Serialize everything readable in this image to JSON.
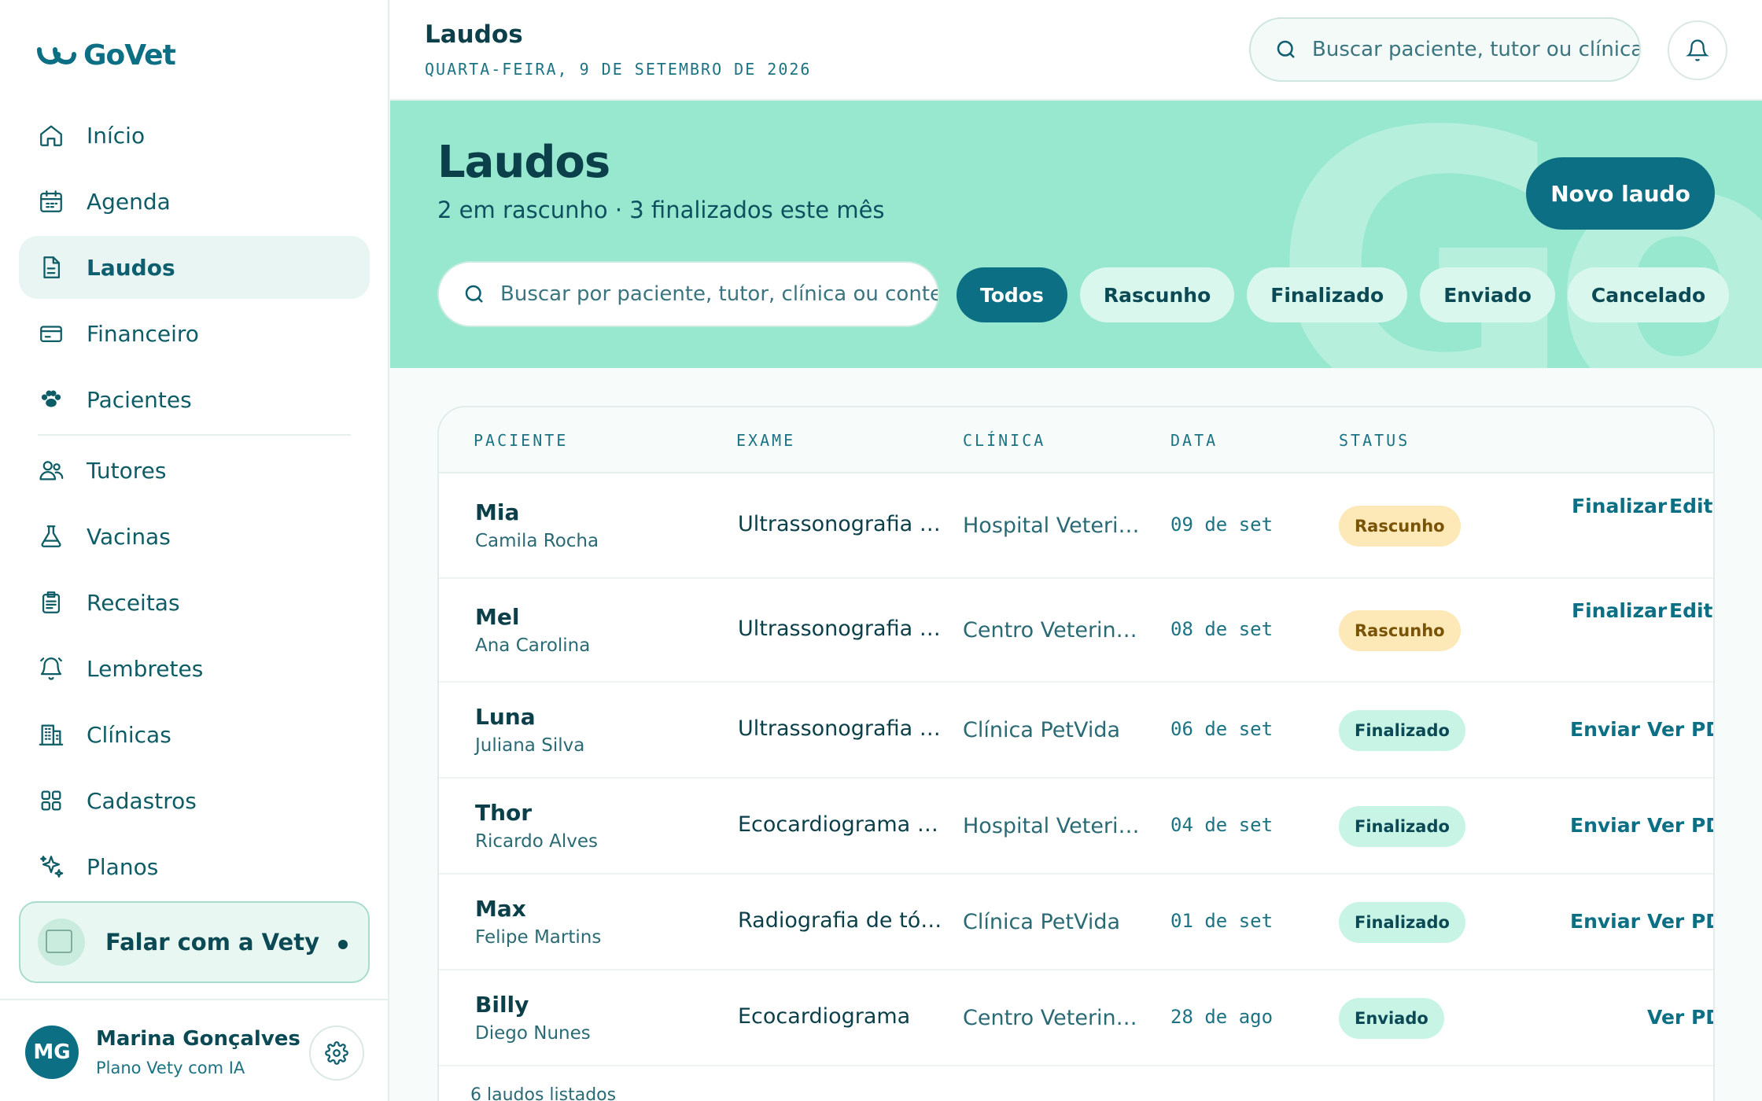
{
  "brand": {
    "name": "GoVet"
  },
  "nav": {
    "items": [
      {
        "label": "Início",
        "icon": "home-icon"
      },
      {
        "label": "Agenda",
        "icon": "calendar-icon"
      },
      {
        "label": "Laudos",
        "icon": "document-icon"
      },
      {
        "label": "Financeiro",
        "icon": "credit-card-icon"
      },
      {
        "label": "Pacientes",
        "icon": "paw-icon"
      },
      {
        "label": "Tutores",
        "icon": "users-icon"
      },
      {
        "label": "Vacinas",
        "icon": "flask-icon"
      },
      {
        "label": "Receitas",
        "icon": "clipboard-icon"
      },
      {
        "label": "Lembretes",
        "icon": "bell-ring-icon"
      },
      {
        "label": "Clínicas",
        "icon": "building-icon"
      },
      {
        "label": "Cadastros",
        "icon": "grid-icon"
      },
      {
        "label": "Planos",
        "icon": "sparkles-icon"
      }
    ],
    "active": "Laudos"
  },
  "assistant": {
    "label": "Falar com a Vety"
  },
  "user": {
    "initials": "MG",
    "name": "Marina Gonçalves",
    "plan": "Plano Vety com IA"
  },
  "topbar": {
    "title": "Laudos",
    "date": "QUARTA-FEIRA, 9 DE SETEMBRO DE 2026",
    "search_placeholder": "Buscar paciente, tutor ou clínica"
  },
  "hero": {
    "watermark": "Go",
    "title": "Laudos",
    "subtitle": "2 em rascunho · 3 finalizados este mês",
    "new_button": "Novo laudo",
    "search_placeholder": "Buscar por paciente, tutor, clínica ou conteúdo",
    "filters": [
      "Todos",
      "Rascunho",
      "Finalizado",
      "Enviado",
      "Cancelado"
    ],
    "active_filter": "Todos"
  },
  "table": {
    "headers": [
      "PACIENTE",
      "EXAME",
      "CLÍNICA",
      "DATA",
      "STATUS"
    ],
    "rows": [
      {
        "name": "Mia",
        "tutor": "Camila Rocha",
        "exam": "Ultrassonografia de abdome",
        "clinic": "Hospital Veterinário",
        "date": "09 de set",
        "status": "Rascunho",
        "status_type": "rasc",
        "actions": [
          "Finalizar",
          "Editar"
        ]
      },
      {
        "name": "Mel",
        "tutor": "Ana Carolina",
        "exam": "Ultrassonografia abdominal",
        "clinic": "Centro Veterinário",
        "date": "08 de set",
        "status": "Rascunho",
        "status_type": "rasc",
        "actions": [
          "Finalizar",
          "Editar"
        ]
      },
      {
        "name": "Luna",
        "tutor": "Juliana Silva",
        "exam": "Ultrassonografia abdominal",
        "clinic": "Clínica PetVida",
        "date": "06 de set",
        "status": "Finalizado",
        "status_type": "fin",
        "actions": [
          "Enviar",
          "Ver PDF"
        ]
      },
      {
        "name": "Thor",
        "tutor": "Ricardo Alves",
        "exam": "Ecocardiograma completo",
        "clinic": "Hospital Veterinário",
        "date": "04 de set",
        "status": "Finalizado",
        "status_type": "fin",
        "actions": [
          "Enviar",
          "Ver PDF"
        ]
      },
      {
        "name": "Max",
        "tutor": "Felipe Martins",
        "exam": "Radiografia de tórax",
        "clinic": "Clínica PetVida",
        "date": "01 de set",
        "status": "Finalizado",
        "status_type": "fin",
        "actions": [
          "Enviar",
          "Ver PDF"
        ]
      },
      {
        "name": "Billy",
        "tutor": "Diego Nunes",
        "exam": "Ecocardiograma",
        "clinic": "Centro Veterinário",
        "date": "28 de ago",
        "status": "Enviado",
        "status_type": "env",
        "actions": [
          "Ver PDF"
        ]
      }
    ],
    "footer": "6 laudos listados"
  },
  "colors": {
    "primary": "#0d6f84",
    "hero_bg": "#97e8cf",
    "draft": "#fde8b8",
    "done": "#c8f4e6"
  }
}
